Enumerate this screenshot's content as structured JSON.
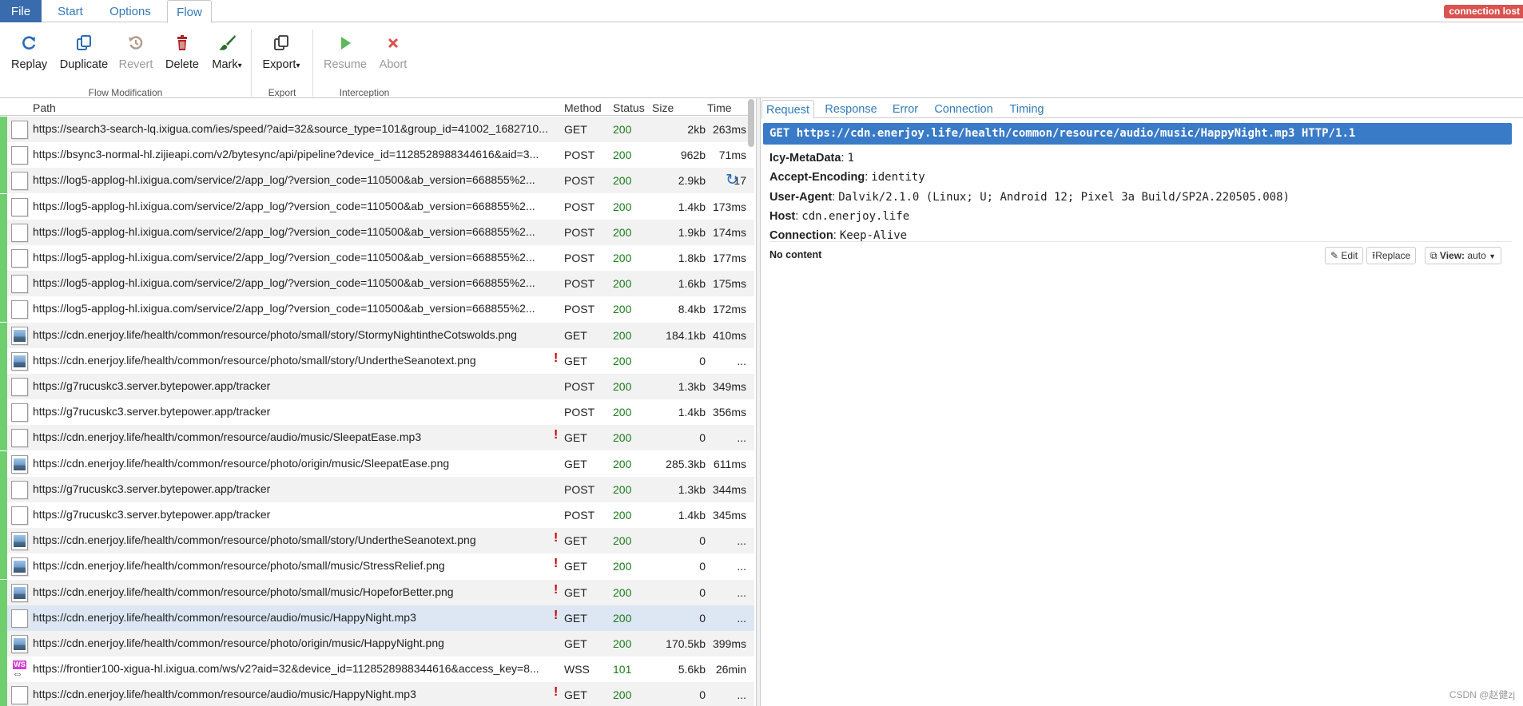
{
  "tabs": {
    "file": "File",
    "start": "Start",
    "options": "Options",
    "flow": "Flow"
  },
  "status_badge": "connection lost",
  "ribbon": {
    "buttons": {
      "replay": "Replay",
      "duplicate": "Duplicate",
      "revert": "Revert",
      "delete": "Delete",
      "mark": "Mark",
      "export": "Export",
      "resume": "Resume",
      "abort": "Abort"
    },
    "dropdown_caret": "▾",
    "groups": {
      "modification": "Flow Modification",
      "export": "Export",
      "interception": "Interception"
    },
    "colors": {
      "replay": "#2a6db5",
      "delete": "#b22222",
      "mark": "#2e6b2e",
      "resume": "#5cb85c",
      "abort": "#d9534f"
    }
  },
  "table": {
    "headers": {
      "path": "Path",
      "method": "Method",
      "status": "Status",
      "size": "Size",
      "time": "Time"
    },
    "rows": [
      {
        "icon": "file-icon",
        "path": "https://search3-search-lq.ixigua.com/ies/speed/?aid=32&source_type=101&group_id=41002_1682710...",
        "err": "",
        "method": "GET",
        "status": "200",
        "size": "2kb",
        "time": "263ms"
      },
      {
        "icon": "file-icon",
        "path": "https://bsync3-normal-hl.zijieapi.com/v2/bytesync/api/pipeline?device_id=1128528988344616&aid=3...",
        "err": "",
        "method": "POST",
        "status": "200",
        "size": "962b",
        "time": "71ms"
      },
      {
        "icon": "file-icon",
        "path": "https://log5-applog-hl.ixigua.com/service/2/app_log/?version_code=110500&ab_version=668855%2...",
        "err": "",
        "method": "POST",
        "status": "200",
        "size": "2.9kb",
        "time": "17"
      },
      {
        "icon": "file-icon",
        "path": "https://log5-applog-hl.ixigua.com/service/2/app_log/?version_code=110500&ab_version=668855%2...",
        "err": "",
        "method": "POST",
        "status": "200",
        "size": "1.4kb",
        "time": "173ms"
      },
      {
        "icon": "file-icon",
        "path": "https://log5-applog-hl.ixigua.com/service/2/app_log/?version_code=110500&ab_version=668855%2...",
        "err": "",
        "method": "POST",
        "status": "200",
        "size": "1.9kb",
        "time": "174ms"
      },
      {
        "icon": "file-icon",
        "path": "https://log5-applog-hl.ixigua.com/service/2/app_log/?version_code=110500&ab_version=668855%2...",
        "err": "",
        "method": "POST",
        "status": "200",
        "size": "1.8kb",
        "time": "177ms"
      },
      {
        "icon": "file-icon",
        "path": "https://log5-applog-hl.ixigua.com/service/2/app_log/?version_code=110500&ab_version=668855%2...",
        "err": "",
        "method": "POST",
        "status": "200",
        "size": "1.6kb",
        "time": "175ms"
      },
      {
        "icon": "file-icon",
        "path": "https://log5-applog-hl.ixigua.com/service/2/app_log/?version_code=110500&ab_version=668855%2...",
        "err": "",
        "method": "POST",
        "status": "200",
        "size": "8.4kb",
        "time": "172ms"
      },
      {
        "icon": "image-icon",
        "path": "https://cdn.enerjoy.life/health/common/resource/photo/small/story/StormyNightintheCotswolds.png",
        "err": "",
        "method": "GET",
        "status": "200",
        "size": "184.1kb",
        "time": "410ms"
      },
      {
        "icon": "image-icon",
        "path": "https://cdn.enerjoy.life/health/common/resource/photo/small/story/UndertheSeanotext.png",
        "err": "!",
        "method": "GET",
        "status": "200",
        "size": "0",
        "time": "..."
      },
      {
        "icon": "file-icon",
        "path": "https://g7rucuskc3.server.bytepower.app/tracker",
        "err": "",
        "method": "POST",
        "status": "200",
        "size": "1.3kb",
        "time": "349ms"
      },
      {
        "icon": "file-icon",
        "path": "https://g7rucuskc3.server.bytepower.app/tracker",
        "err": "",
        "method": "POST",
        "status": "200",
        "size": "1.4kb",
        "time": "356ms"
      },
      {
        "icon": "file-icon",
        "path": "https://cdn.enerjoy.life/health/common/resource/audio/music/SleepatEase.mp3",
        "err": "!",
        "method": "GET",
        "status": "200",
        "size": "0",
        "time": "..."
      },
      {
        "icon": "image-icon",
        "path": "https://cdn.enerjoy.life/health/common/resource/photo/origin/music/SleepatEase.png",
        "err": "",
        "method": "GET",
        "status": "200",
        "size": "285.3kb",
        "time": "611ms"
      },
      {
        "icon": "file-icon",
        "path": "https://g7rucuskc3.server.bytepower.app/tracker",
        "err": "",
        "method": "POST",
        "status": "200",
        "size": "1.3kb",
        "time": "344ms"
      },
      {
        "icon": "file-icon",
        "path": "https://g7rucuskc3.server.bytepower.app/tracker",
        "err": "",
        "method": "POST",
        "status": "200",
        "size": "1.4kb",
        "time": "345ms"
      },
      {
        "icon": "image-icon",
        "path": "https://cdn.enerjoy.life/health/common/resource/photo/small/story/UndertheSeanotext.png",
        "err": "!",
        "method": "GET",
        "status": "200",
        "size": "0",
        "time": "..."
      },
      {
        "icon": "image-icon",
        "path": "https://cdn.enerjoy.life/health/common/resource/photo/small/music/StressRelief.png",
        "err": "!",
        "method": "GET",
        "status": "200",
        "size": "0",
        "time": "..."
      },
      {
        "icon": "image-icon",
        "path": "https://cdn.enerjoy.life/health/common/resource/photo/small/music/HopeforBetter.png",
        "err": "!",
        "method": "GET",
        "status": "200",
        "size": "0",
        "time": "..."
      },
      {
        "icon": "file-icon",
        "path": "https://cdn.enerjoy.life/health/common/resource/audio/music/HappyNight.mp3",
        "err": "!",
        "method": "GET",
        "status": "200",
        "size": "0",
        "time": "...",
        "selected": true
      },
      {
        "icon": "image-icon",
        "path": "https://cdn.enerjoy.life/health/common/resource/photo/origin/music/HappyNight.png",
        "err": "",
        "method": "GET",
        "status": "200",
        "size": "170.5kb",
        "time": "399ms"
      },
      {
        "icon": "websocket-icon",
        "path": "https://frontier100-xigua-hl.ixigua.com/ws/v2?aid=32&device_id=1128528988344616&access_key=8...",
        "err": "",
        "method": "WSS",
        "status": "101",
        "size": "5.6kb",
        "time": "26min"
      },
      {
        "icon": "file-icon",
        "path": "https://cdn.enerjoy.life/health/common/resource/audio/music/HappyNight.mp3",
        "err": "!",
        "method": "GET",
        "status": "200",
        "size": "0",
        "time": "..."
      }
    ]
  },
  "details": {
    "tabs": {
      "request": "Request",
      "response": "Response",
      "error": "Error",
      "connection": "Connection",
      "timing": "Timing"
    },
    "request_line": "GET https://cdn.enerjoy.life/health/common/resource/audio/music/HappyNight.mp3 HTTP/1.1",
    "headers": [
      {
        "name": "Icy-MetaData",
        "value": "1"
      },
      {
        "name": "Accept-Encoding",
        "value": "identity"
      },
      {
        "name": "User-Agent",
        "value": "Dalvik/2.1.0 (Linux; U; Android 12; Pixel 3a Build/SP2A.220505.008)"
      },
      {
        "name": "Host",
        "value": "cdn.enerjoy.life"
      },
      {
        "name": "Connection",
        "value": "Keep-Alive"
      }
    ],
    "no_content": "No content",
    "edit_label": "Edit",
    "replace_label": "Replace",
    "view_label": "View:",
    "view_value": "auto"
  },
  "watermark": "CSDN @赵健zj"
}
